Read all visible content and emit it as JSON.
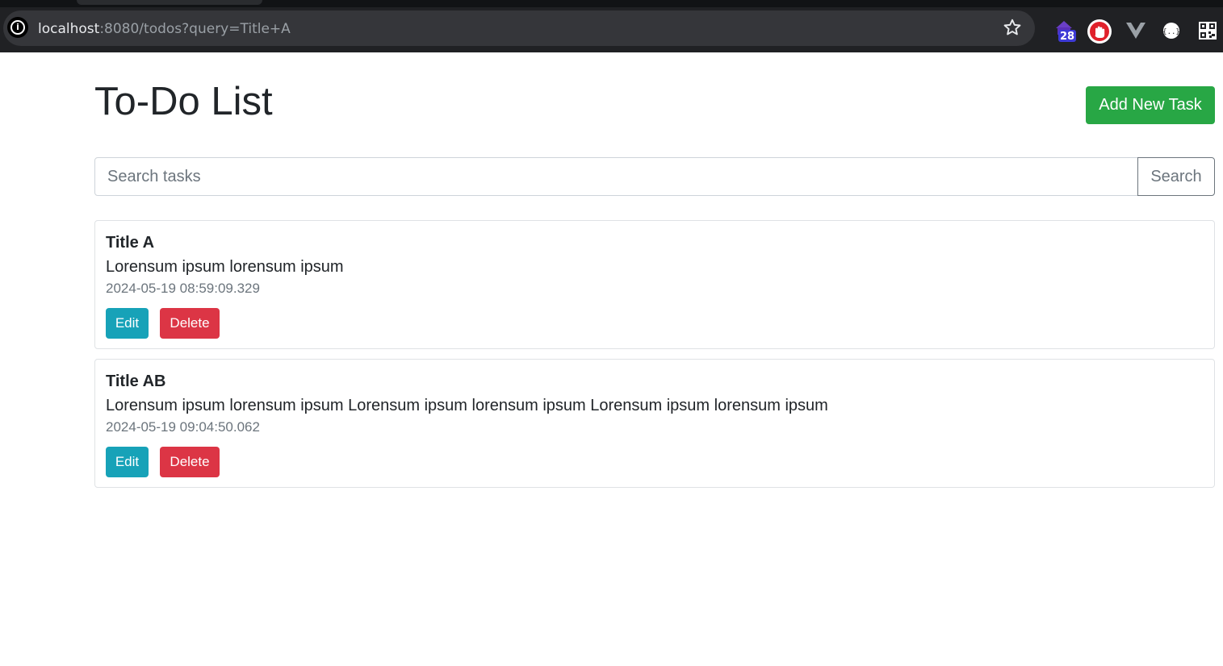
{
  "browser": {
    "url_host": "localhost",
    "url_rest": ":8080/todos?query=Title+A",
    "extensions": [
      {
        "icon": "purple-house-icon",
        "badge": "28"
      },
      {
        "icon": "red-hand-icon"
      },
      {
        "icon": "vue-devtools-icon"
      },
      {
        "icon": "json-viewer-icon"
      },
      {
        "icon": "qr-code-icon"
      }
    ]
  },
  "page": {
    "title": "To-Do List",
    "add_button": "Add New Task",
    "search": {
      "placeholder": "Search tasks",
      "value": "",
      "button": "Search"
    },
    "tasks": [
      {
        "title": "Title A",
        "description": "Lorensum ipsum lorensum ipsum",
        "timestamp": "2024-05-19 08:59:09.329",
        "edit_label": "Edit",
        "delete_label": "Delete"
      },
      {
        "title": "Title AB",
        "description": "Lorensum ipsum lorensum ipsum Lorensum ipsum lorensum ipsum Lorensum ipsum lorensum ipsum",
        "timestamp": "2024-05-19 09:04:50.062",
        "edit_label": "Edit",
        "delete_label": "Delete"
      }
    ]
  },
  "colors": {
    "success": "#28a745",
    "info": "#17a2b8",
    "danger": "#dc3545",
    "text": "#212529",
    "muted": "#6c757d"
  }
}
